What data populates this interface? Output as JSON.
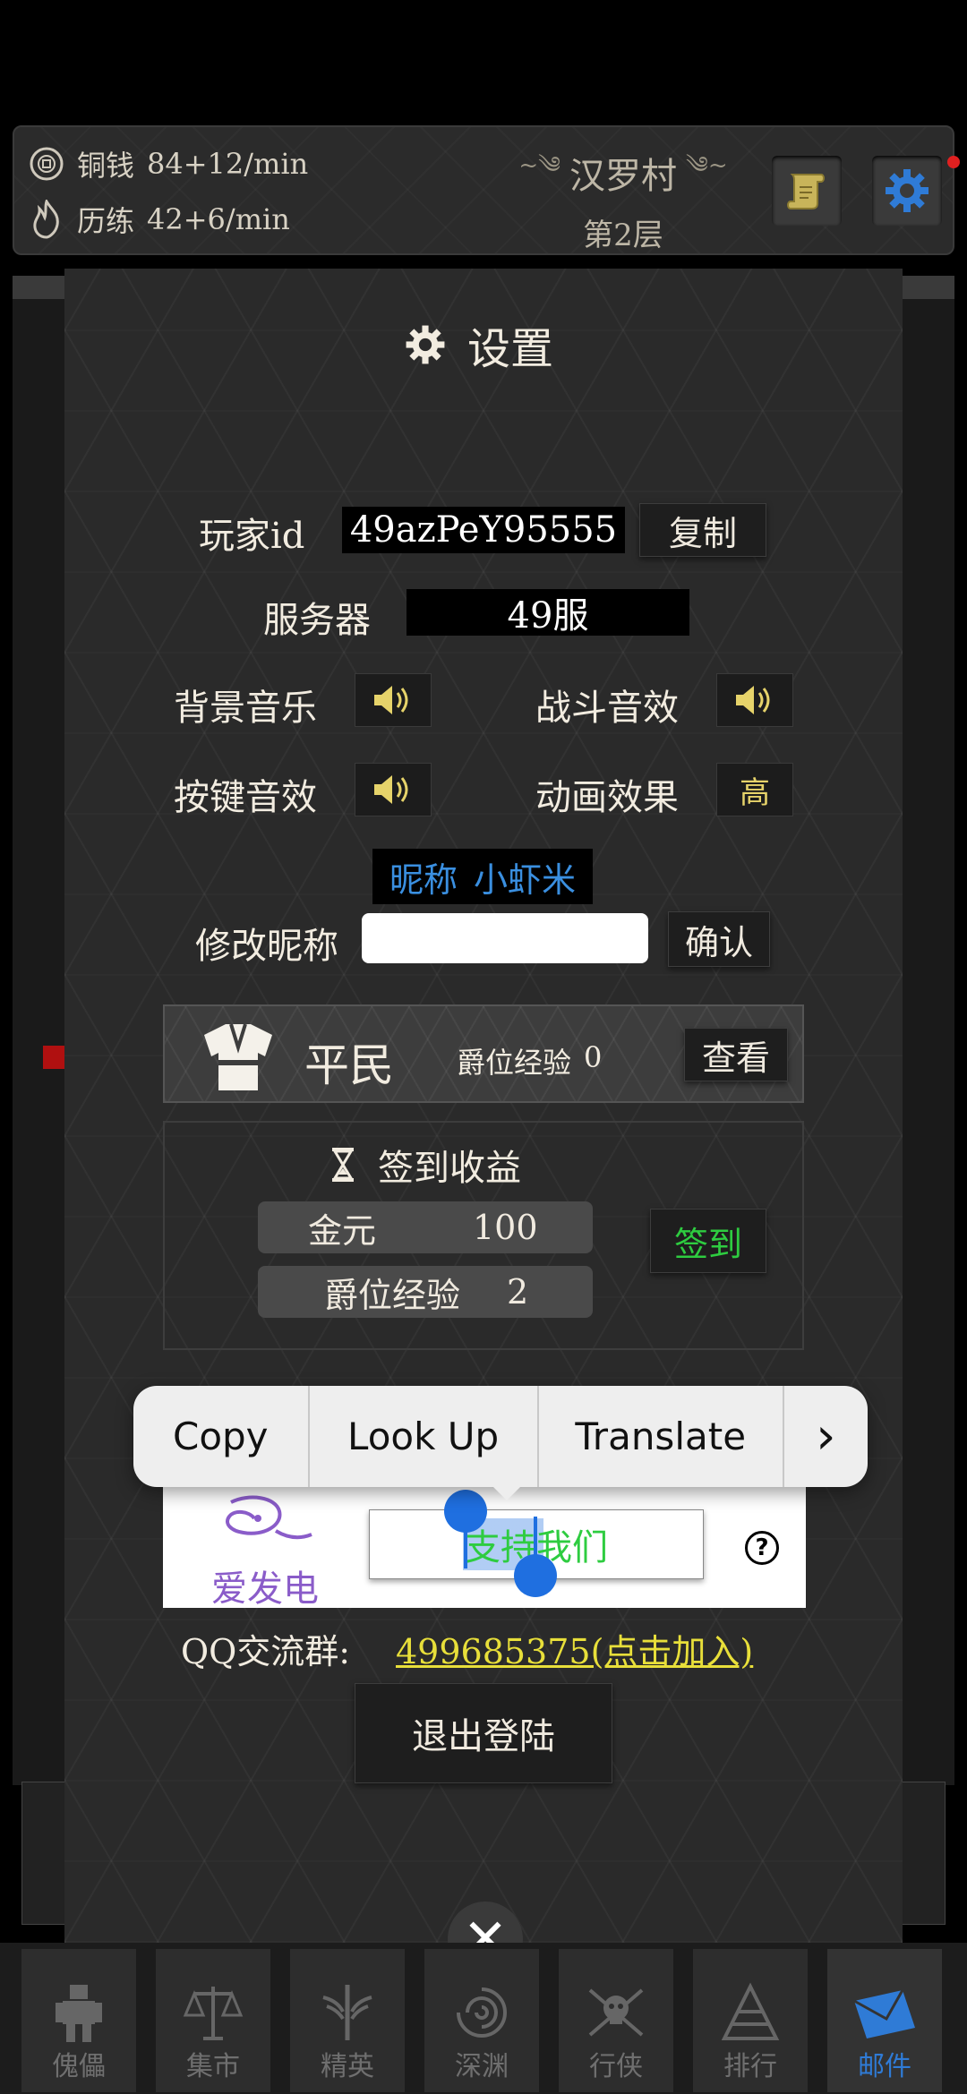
{
  "topbar": {
    "coins": {
      "label": "铜钱",
      "value": "84+12/min"
    },
    "exp": {
      "label": "历练",
      "value": "42+6/min"
    },
    "location": "汉罗村",
    "floor": "第2层"
  },
  "settings": {
    "title": "设置",
    "player_id_label": "玩家id",
    "player_id_value": "49azPeY95555",
    "copy_button": "复制",
    "server_label": "服务器",
    "server_value": "49服",
    "bgm_label": "背景音乐",
    "battle_sfx_label": "战斗音效",
    "key_sfx_label": "按键音效",
    "animation_label": "动画效果",
    "animation_value": "高",
    "nickname_label": "昵称",
    "nickname_value": "小虾米",
    "change_nickname_label": "修改昵称",
    "change_nickname_placeholder": "",
    "confirm_button": "确认",
    "rank_name": "平民",
    "rank_exp_label": "爵位经验",
    "rank_exp_value": "0",
    "view_button": "查看",
    "checkin_title": "签到收益",
    "checkin_rewards": [
      {
        "label": "金元",
        "value": "100"
      },
      {
        "label": "爵位经验",
        "value": "2"
      }
    ],
    "checkin_button": "签到",
    "afdian_label": "爱发电",
    "support_button": "支持我们",
    "help_icon": "?",
    "qq_label": "QQ交流群:",
    "qq_link": "499685375(点击加入)",
    "logout_button": "退出登陆",
    "close_glyph": "✕"
  },
  "context_menu": {
    "items": [
      "Copy",
      "Look Up",
      "Translate"
    ],
    "more_glyph": "›"
  },
  "nav": {
    "tabs": [
      "傀儡",
      "集市",
      "精英",
      "深渊",
      "行侠",
      "排行",
      "邮件"
    ],
    "active_index": 6
  },
  "colors": {
    "accent_blue": "#2f7bd6",
    "nickname_blue": "#3a8fe0",
    "checkin_green": "#2ecc40",
    "link_yellow": "#e8df3a",
    "afdian_purple": "#8a5cc9",
    "selection_blue": "#1f6fe0"
  }
}
